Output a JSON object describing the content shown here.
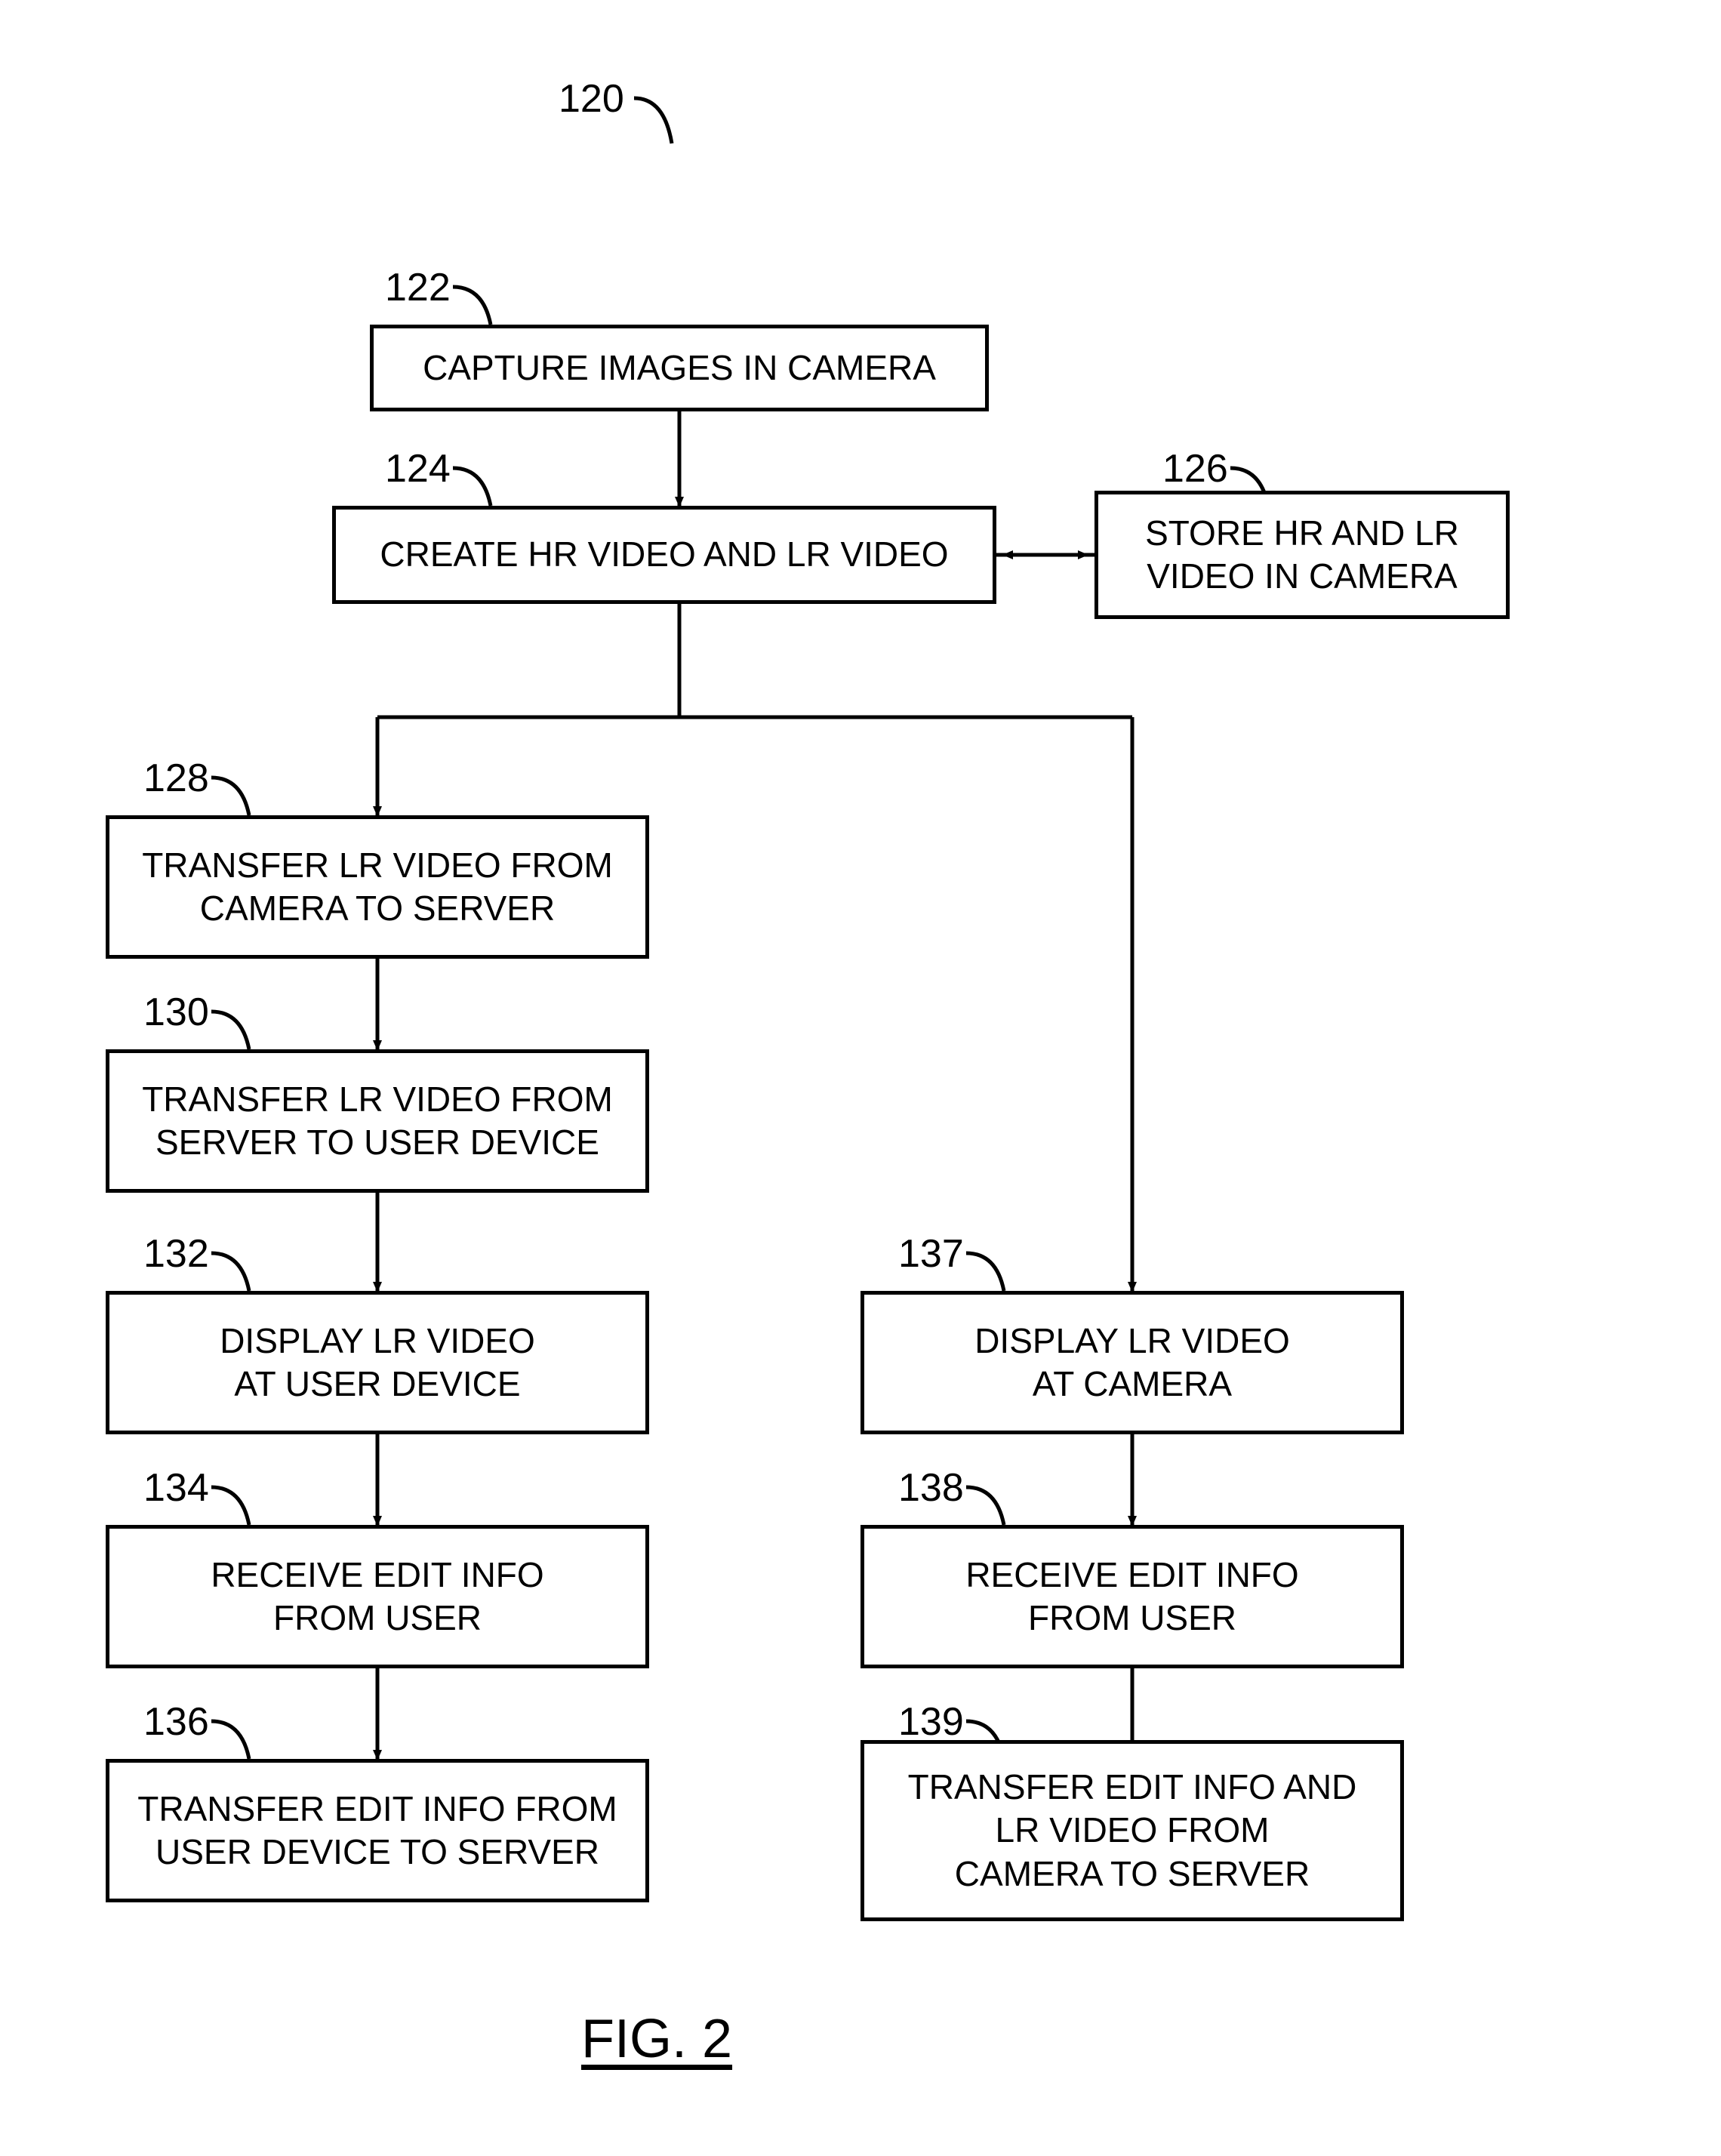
{
  "figure_ref": "120",
  "figure_caption": "FIG. 2",
  "nodes": {
    "n122": {
      "ref": "122",
      "text": "CAPTURE IMAGES IN CAMERA"
    },
    "n124": {
      "ref": "124",
      "text": "CREATE HR VIDEO AND LR VIDEO"
    },
    "n126": {
      "ref": "126",
      "text": "STORE HR AND LR\nVIDEO IN CAMERA"
    },
    "n128": {
      "ref": "128",
      "text": "TRANSFER LR VIDEO FROM\nCAMERA TO SERVER"
    },
    "n130": {
      "ref": "130",
      "text": "TRANSFER LR VIDEO FROM\nSERVER TO USER DEVICE"
    },
    "n132": {
      "ref": "132",
      "text": "DISPLAY LR VIDEO\nAT USER DEVICE"
    },
    "n134": {
      "ref": "134",
      "text": "RECEIVE EDIT INFO\nFROM USER"
    },
    "n136": {
      "ref": "136",
      "text": "TRANSFER EDIT INFO FROM\nUSER DEVICE TO SERVER"
    },
    "n137": {
      "ref": "137",
      "text": "DISPLAY LR VIDEO\nAT CAMERA"
    },
    "n138": {
      "ref": "138",
      "text": "RECEIVE EDIT INFO\nFROM USER"
    },
    "n139": {
      "ref": "139",
      "text": "TRANSFER EDIT INFO AND\nLR VIDEO FROM\nCAMERA TO SERVER"
    }
  }
}
